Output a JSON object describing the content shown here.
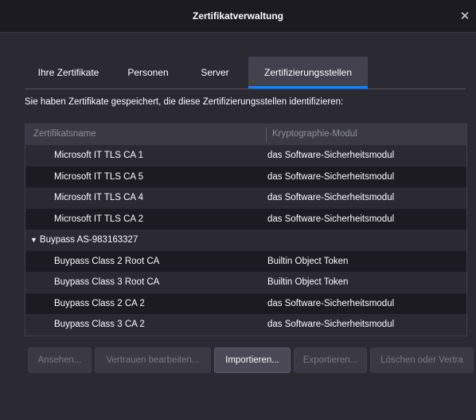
{
  "window": {
    "title": "Zertifikatverwaltung",
    "close_glyph": "✕"
  },
  "tabs": [
    {
      "label": "Ihre Zertifikate"
    },
    {
      "label": "Personen"
    },
    {
      "label": "Server"
    },
    {
      "label": "Zertifizierungsstellen",
      "active": true
    }
  ],
  "intro_text": "Sie haben Zertifikate gespeichert, die diese Zertifizierungsstellen identifizieren:",
  "table": {
    "columns": [
      "Zertifikatsname",
      "Kryptographie-Modul"
    ],
    "rows": [
      {
        "name": "Microsoft IT TLS CA 1",
        "module": "das Software-Sicherheitsmodul"
      },
      {
        "name": "Microsoft IT TLS CA 5",
        "module": "das Software-Sicherheitsmodul"
      },
      {
        "name": "Microsoft IT TLS CA 4",
        "module": "das Software-Sicherheitsmodul"
      },
      {
        "name": "Microsoft IT TLS CA 2",
        "module": "das Software-Sicherheitsmodul"
      },
      {
        "name": "Buypass AS-983163327",
        "module": "",
        "group": true
      },
      {
        "name": "Buypass Class 2 Root CA",
        "module": "Builtin Object Token"
      },
      {
        "name": "Buypass Class 3 Root CA",
        "module": "Builtin Object Token"
      },
      {
        "name": "Buypass Class 2 CA 2",
        "module": "das Software-Sicherheitsmodul"
      },
      {
        "name": "Buypass Class 3 CA 2",
        "module": "das Software-Sicherheitsmodul"
      }
    ]
  },
  "buttons": {
    "view": "Ansehen...",
    "edit_trust": "Vertrauen bearbeiten...",
    "import": "Importieren...",
    "export": "Exportieren...",
    "delete": "Löschen oder Vertra"
  },
  "colors": {
    "accent": "#0a84ff",
    "background": "#2b2a33",
    "list_background": "#1c1b22"
  },
  "icons": {
    "group_expander": "chevron-down-icon",
    "close": "close-icon"
  }
}
